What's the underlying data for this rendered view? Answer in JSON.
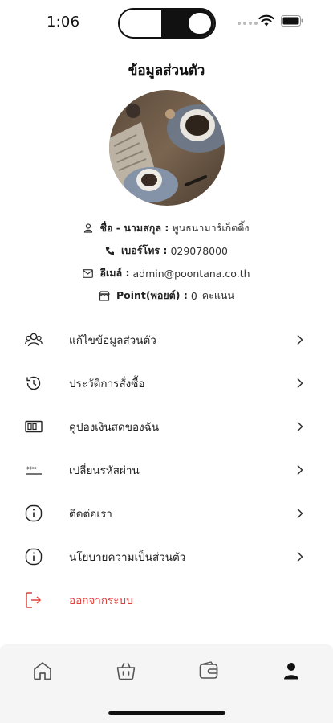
{
  "status_bar": {
    "time": "1:06"
  },
  "header": {
    "title": "ข้อมูลส่วนตัว"
  },
  "profile": {
    "name_label": "ชื่อ - นามสกุล :",
    "name_value": "พูนธนามาร์เก็ตติ้ง",
    "phone_label": "เบอร์โทร :",
    "phone_value": "029078000",
    "email_label": "อีเมล์ :",
    "email_value": "admin@poontana.co.th",
    "point_label": "Point(พอยต์) :",
    "point_value": "0",
    "point_unit": "คะแนน"
  },
  "menu": {
    "items": [
      {
        "label": "แก้ไขข้อมูลส่วนตัว",
        "icon": "users-icon"
      },
      {
        "label": "ประวัติการสั่งซื้อ",
        "icon": "history-icon"
      },
      {
        "label": "คูปองเงินสดของฉัน",
        "icon": "coupon-icon"
      },
      {
        "label": "เปลี่ยนรหัสผ่าน",
        "icon": "password-icon"
      },
      {
        "label": "ติดต่อเรา",
        "icon": "info-icon"
      },
      {
        "label": "นโยบายความเป็นส่วนตัว",
        "icon": "info-icon"
      }
    ],
    "logout_label": "ออกจากระบบ"
  },
  "colors": {
    "logout": "#e0413c",
    "nav_bg": "#f5f5f5"
  },
  "bottom_nav": {
    "active": "profile"
  }
}
